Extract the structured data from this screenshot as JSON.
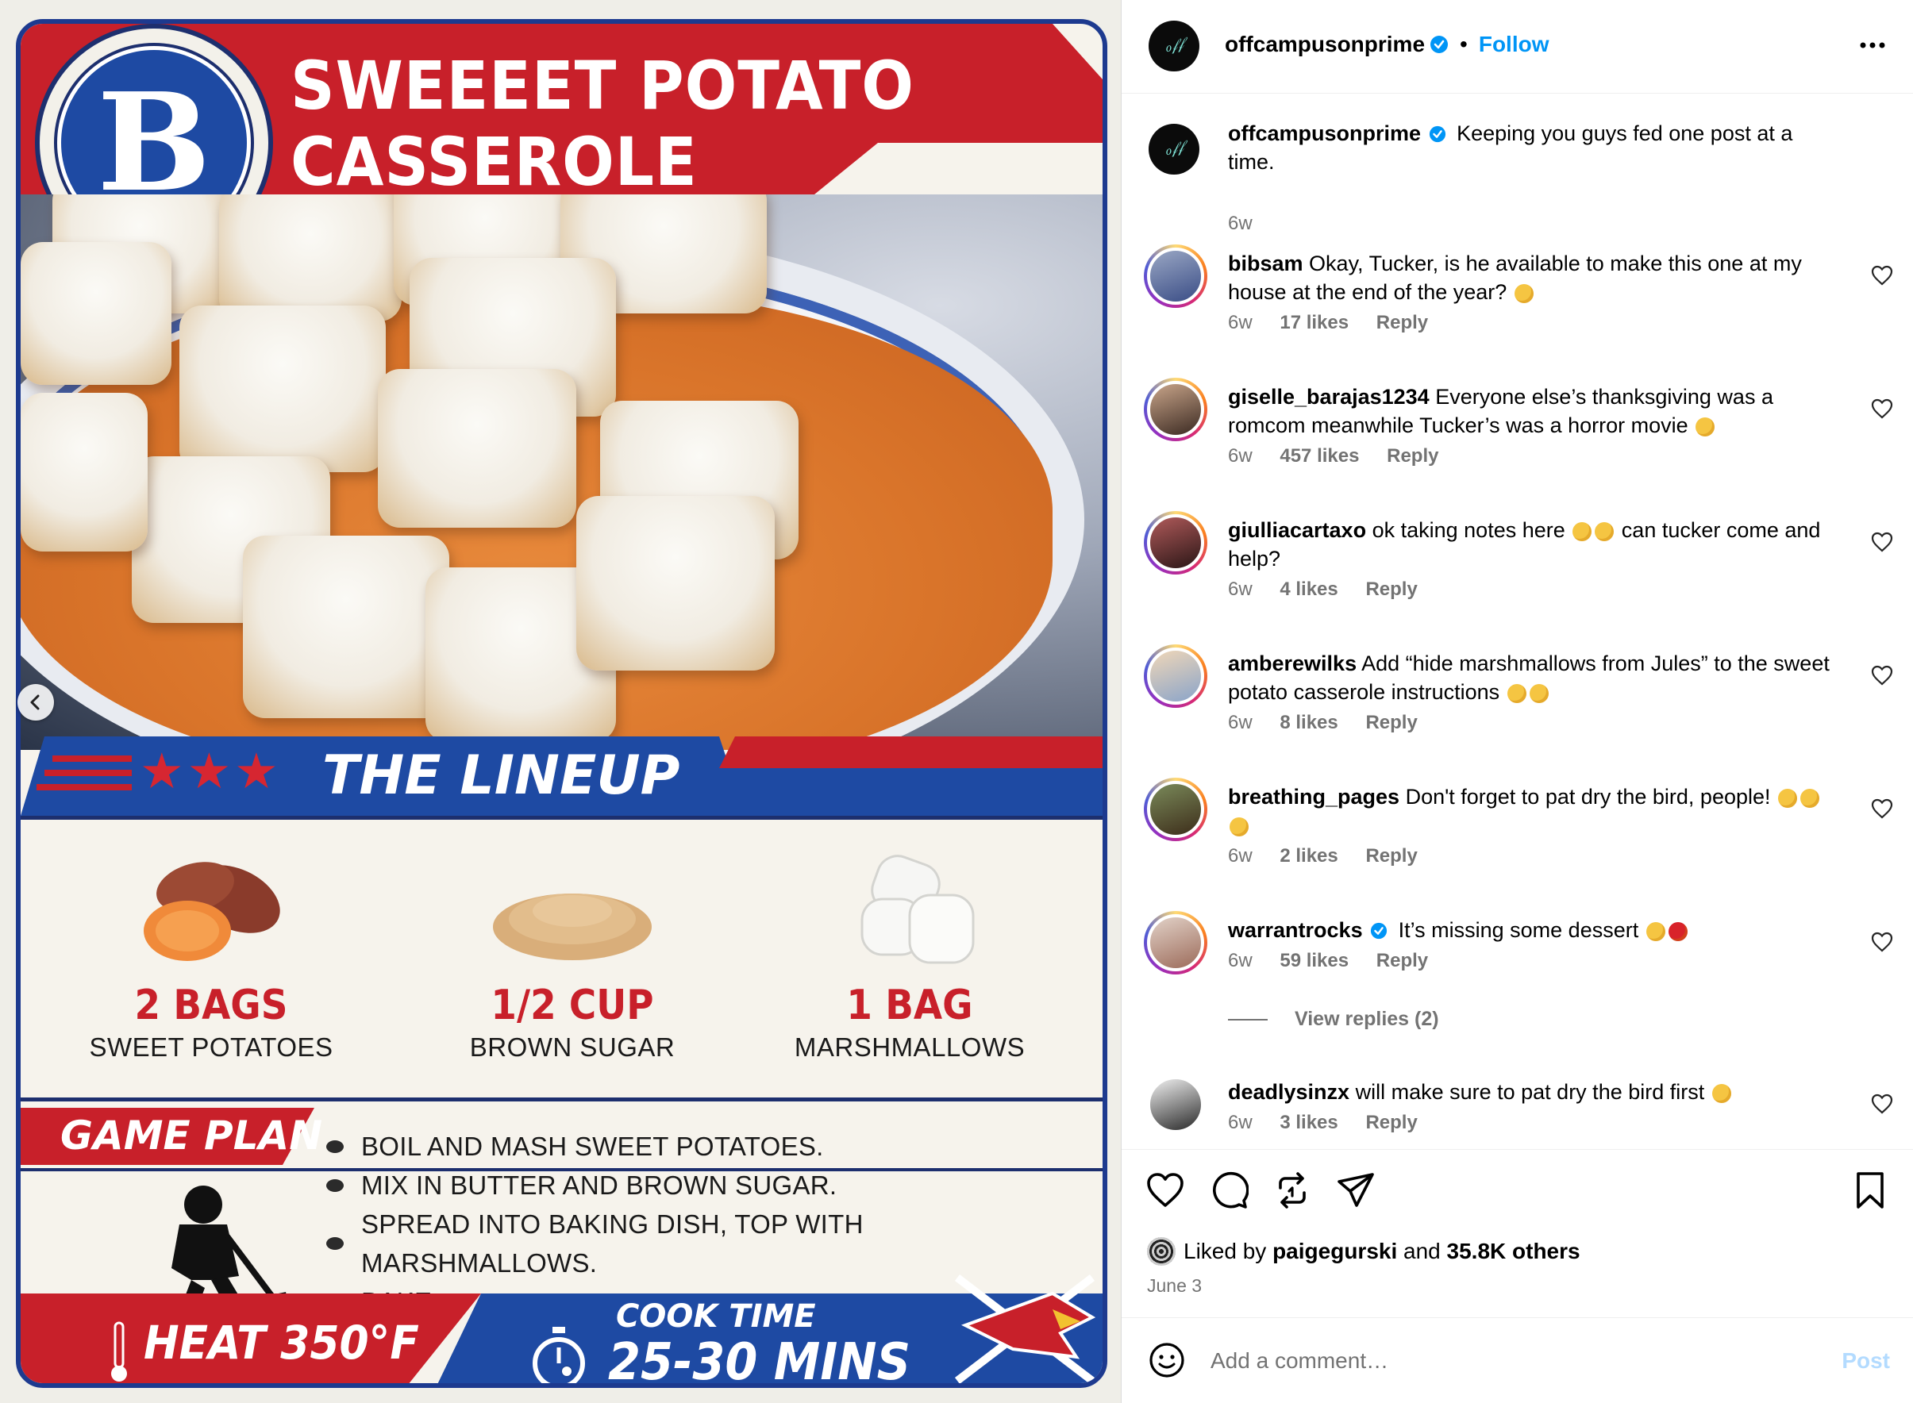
{
  "media": {
    "badge_letter": "B",
    "title_line1": "SWEEEET POTATO",
    "title_line2": "CASSEROLE",
    "lineup_heading": "THE LINEUP",
    "ingredients": [
      {
        "qty": "2 BAGS",
        "name": "SWEET POTATOES"
      },
      {
        "qty": "1/2 CUP",
        "name": "BROWN SUGAR"
      },
      {
        "qty": "1 BAG",
        "name": "MARSHMALLOWS"
      }
    ],
    "game_plan_heading": "GAME PLAN",
    "steps": [
      "BOIL AND MASH SWEET POTATOES.",
      "MIX IN BUTTER AND BROWN SUGAR.",
      "SPREAD INTO BAKING DISH, TOP WITH MARSHMALLOWS.",
      "BAKE."
    ],
    "heat": "HEAT 350°F",
    "cook_time_label": "COOK TIME",
    "cook_time_value": "25-30 MINS"
  },
  "header": {
    "username": "offcampusonprime",
    "follow_label": "Follow",
    "separator": "•"
  },
  "caption": {
    "username": "offcampusonprime",
    "text": "Keeping you guys fed one post at a time.",
    "age": "6w"
  },
  "comments": [
    {
      "username": "bibsam",
      "text": "Okay, Tucker, is he available to make this one at my house at the end of the year?",
      "age": "6w",
      "likes": "17 likes",
      "reply": "Reply"
    },
    {
      "username": "giselle_barajas1234",
      "text": "Everyone else’s thanksgiving was a romcom meanwhile Tucker’s was a horror movie",
      "age": "6w",
      "likes": "457 likes",
      "reply": "Reply"
    },
    {
      "username": "giulliacartaxo",
      "text": "ok taking notes here",
      "text2": "can tucker come and help?",
      "age": "6w",
      "likes": "4 likes",
      "reply": "Reply"
    },
    {
      "username": "amberewilks",
      "text": "Add “hide marshmallows from Jules” to the sweet potato casserole instructions",
      "age": "6w",
      "likes": "8 likes",
      "reply": "Reply"
    },
    {
      "username": "breathing_pages",
      "text": "Don't forget to pat dry the bird, people!",
      "age": "6w",
      "likes": "2 likes",
      "reply": "Reply"
    },
    {
      "username": "warrantrocks",
      "text": "It’s missing some dessert",
      "age": "6w",
      "likes": "59 likes",
      "reply": "Reply"
    },
    {
      "username": "deadlysinzx",
      "text": "will make sure to pat dry the bird first",
      "age": "6w",
      "likes": "3 likes",
      "reply": "Reply"
    }
  ],
  "view_replies": "View replies (2)",
  "likes": {
    "prefix": "Liked by",
    "user": "paigegurski",
    "and": "and",
    "others": "35.8K others"
  },
  "date": "June 3",
  "add_comment": {
    "placeholder": "Add a comment…",
    "post_label": "Post"
  },
  "colors": {
    "accent_blue": "#0095f6",
    "card_red": "#c8202a",
    "card_blue": "#1e4aa3"
  },
  "icons": [
    "chevron-left-icon",
    "verified-icon",
    "more-icon",
    "heart-icon",
    "comment-icon",
    "repost-icon",
    "share-icon",
    "bookmark-icon",
    "emoji-icon"
  ]
}
